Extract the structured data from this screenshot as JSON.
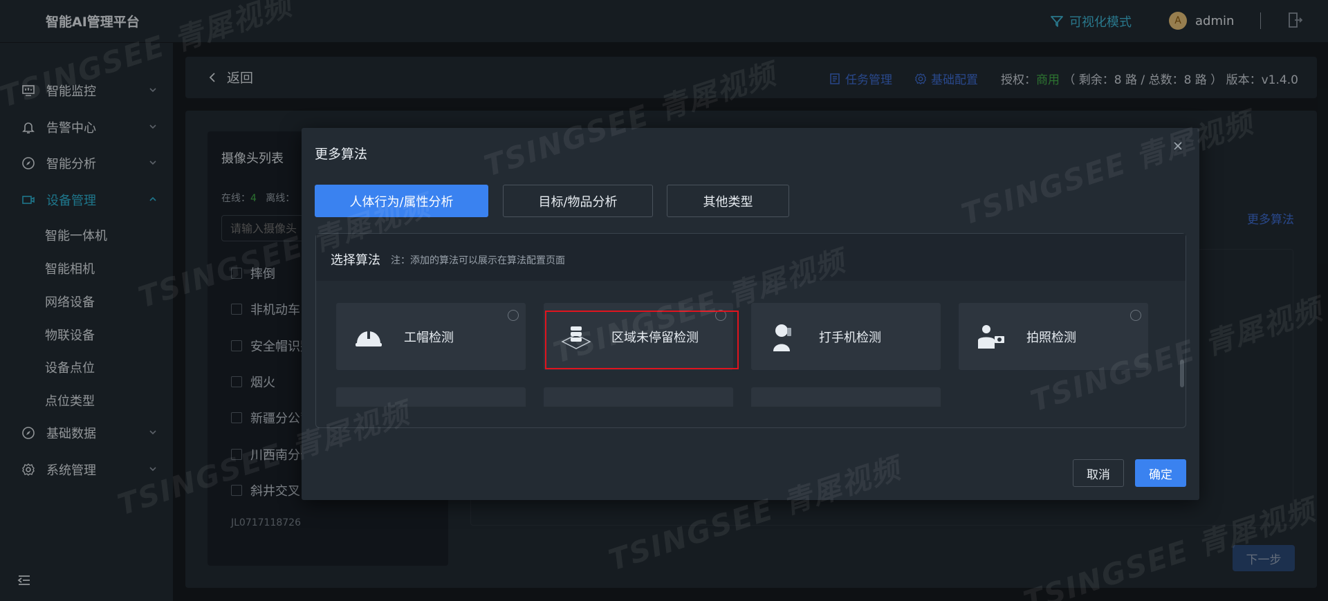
{
  "app": {
    "brand": "智能AI管理平台"
  },
  "topbar": {
    "viz_mode": "可视化模式",
    "avatar_letter": "A",
    "username": "admin"
  },
  "sidebar": {
    "menus": [
      {
        "label": "智能监控",
        "icon": "monitor-icon"
      },
      {
        "label": "告警中心",
        "icon": "bell-icon"
      },
      {
        "label": "智能分析",
        "icon": "compass-icon"
      },
      {
        "label": "设备管理",
        "icon": "camera-icon",
        "active": true
      },
      {
        "label": "基础数据",
        "icon": "compass-icon"
      },
      {
        "label": "系统管理",
        "icon": "gear-icon"
      }
    ],
    "sub_items": [
      "智能一体机",
      "智能相机",
      "网络设备",
      "物联设备",
      "设备点位",
      "点位类型"
    ]
  },
  "header": {
    "back": "返回",
    "task_mgmt": "任务管理",
    "basic_config": "基础配置",
    "license_prefix": "授权：",
    "license_type": "商用",
    "license_detail": "（ 剩余：8 路 / 总数：8 路 ）  版本：v1.4.0"
  },
  "camera_panel": {
    "title": "摄像头列表",
    "online_label": "在线：",
    "online_count": "4",
    "offline_label": "离线：",
    "search_placeholder": "请输入摄像头",
    "rows": [
      "摔倒",
      "非机动车",
      "安全帽识别",
      "烟火",
      "新疆分公司",
      "川西南分公",
      "斜井交叉口",
      "JL0717118726"
    ]
  },
  "page": {
    "more_algo": "更多算法",
    "next": "下一步"
  },
  "modal": {
    "title": "更多算法",
    "tabs": [
      "人体行为/属性分析",
      "目标/物品分析",
      "其他类型"
    ],
    "section_title": "选择算法",
    "section_note": "注：添加的算法可以展示在算法配置页面",
    "cards": [
      {
        "label": "工帽检测",
        "icon": "hardhat-icon"
      },
      {
        "label": "区域未停留检测",
        "icon": "area-stack-icon"
      },
      {
        "label": "打手机检测",
        "icon": "phone-person-icon"
      },
      {
        "label": "拍照检测",
        "icon": "photo-person-icon"
      }
    ],
    "cancel": "取消",
    "ok": "确定"
  },
  "watermark": "TSINGSEE 青犀视频",
  "colors": {
    "accent": "#3a82f0",
    "teal": "#2fb5d6",
    "highlight": "#e0141e",
    "green": "#44b04a"
  }
}
